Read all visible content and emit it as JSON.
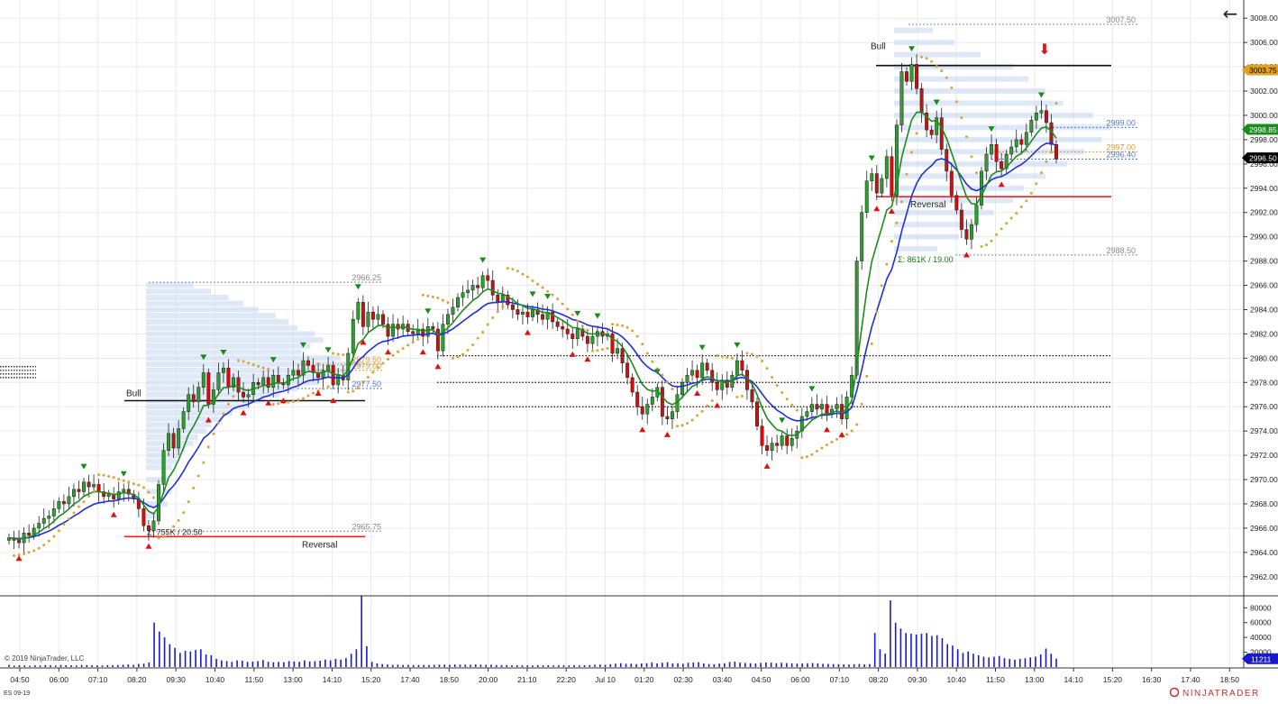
{
  "symbol": "ES 09-19",
  "copyright": "© 2019 NinjaTrader, LLC",
  "brand": "NINJATRADER",
  "icons": {
    "back": "←",
    "down_arrow": "⬇"
  },
  "colors": {
    "bull": "#2e9e2e",
    "bear": "#cc1010",
    "sma_fast": "#1f8a1f",
    "sma_slow": "#1f2fd6",
    "psar": "#d6a43a",
    "volume": "#1a1acc",
    "profile": "#c9d9f2",
    "level_black": "#111111",
    "level_red": "#ee2222",
    "grid": "#eaeaea"
  },
  "chart_data": [
    {
      "type": "candlestick",
      "name": "price",
      "xlabel": "",
      "ylabel": "",
      "ylim": [
        2960.5,
        3009.5
      ],
      "grid": true,
      "x_tick_labels": [
        "04:50",
        "06:00",
        "07:10",
        "08:20",
        "09:30",
        "10:40",
        "11:50",
        "13:00",
        "14:10",
        "15:20",
        "17:40",
        "18:50",
        "20:00",
        "21:10",
        "22:20",
        "Jul 10",
        "01:20",
        "02:30",
        "03:40",
        "04:50",
        "06:00",
        "07:10",
        "08:20",
        "09:30",
        "10:40",
        "11:50",
        "13:00",
        "14:10",
        "15:20",
        "16:30",
        "17:40",
        "18:50"
      ],
      "y_tick_labels": [
        "3008.00",
        "3006.00",
        "3004.00",
        "3002.00",
        "3000.00",
        "2998.00",
        "2996.00",
        "2994.00",
        "2992.00",
        "2990.00",
        "2988.00",
        "2966.00",
        "2984.00",
        "2982.00",
        "2980.00",
        "2978.00",
        "2976.00",
        "2974.00",
        "2972.00",
        "2970.00",
        "2968.00",
        "2966.00",
        "2964.00",
        "2962.00"
      ],
      "y_tick_values": [
        3008,
        3006,
        3004,
        3002,
        3000,
        2998,
        2996,
        2994,
        2992,
        2990,
        2988,
        2986,
        2984,
        2982,
        2980,
        2978,
        2976,
        2974,
        2972,
        2970,
        2968,
        2966,
        2964,
        2962
      ],
      "closes": [
        2965.2,
        2965.0,
        2964.8,
        2965.6,
        2965.4,
        2966.0,
        2966.4,
        2966.8,
        2967.0,
        2967.6,
        2968.2,
        2968.0,
        2968.6,
        2969.2,
        2969.0,
        2969.8,
        2969.4,
        2969.6,
        2969.0,
        2968.6,
        2968.8,
        2968.4,
        2969.0,
        2969.2,
        2968.8,
        2968.4,
        2967.6,
        2966.2,
        2965.8,
        2966.6,
        2969.6,
        2972.4,
        2973.8,
        2972.6,
        2974.2,
        2975.6,
        2977.0,
        2976.4,
        2977.6,
        2978.8,
        2976.2,
        2977.4,
        2978.8,
        2979.2,
        2977.6,
        2978.4,
        2977.2,
        2976.8,
        2977.0,
        2978.0,
        2977.8,
        2978.4,
        2977.6,
        2978.6,
        2978.0,
        2977.8,
        2978.6,
        2979.0,
        2978.6,
        2979.8,
        2979.4,
        2978.8,
        2978.4,
        2979.0,
        2979.4,
        2977.8,
        2978.6,
        2978.2,
        2980.4,
        2983.2,
        2984.6,
        2982.6,
        2983.8,
        2983.2,
        2983.6,
        2982.8,
        2981.8,
        2982.8,
        2982.4,
        2982.8,
        2982.2,
        2982.0,
        2982.4,
        2981.8,
        2982.6,
        2982.4,
        2980.6,
        2982.8,
        2983.6,
        2984.2,
        2985.0,
        2985.4,
        2985.6,
        2986.0,
        2985.8,
        2986.8,
        2986.4,
        2985.2,
        2984.6,
        2985.2,
        2984.4,
        2984.0,
        2983.6,
        2983.8,
        2983.4,
        2984.0,
        2983.6,
        2983.2,
        2983.8,
        2983.0,
        2982.6,
        2982.4,
        2982.0,
        2981.6,
        2982.4,
        2981.8,
        2981.2,
        2981.8,
        2982.2,
        2981.8,
        2982.0,
        2980.4,
        2980.8,
        2979.6,
        2978.4,
        2977.2,
        2976.0,
        2975.4,
        2976.2,
        2976.8,
        2977.6,
        2975.2,
        2975.0,
        2975.6,
        2977.0,
        2978.0,
        2978.6,
        2979.0,
        2978.4,
        2979.6,
        2979.0,
        2978.0,
        2977.4,
        2978.2,
        2977.6,
        2978.6,
        2979.8,
        2979.0,
        2977.4,
        2976.4,
        2974.4,
        2972.8,
        2972.4,
        2973.0,
        2972.8,
        2973.6,
        2972.8,
        2973.4,
        2974.0,
        2975.2,
        2975.6,
        2976.2,
        2975.8,
        2976.2,
        2975.4,
        2975.8,
        2976.2,
        2975.0,
        2976.8,
        2978.6,
        2988.0,
        2992.0,
        2994.6,
        2995.2,
        2993.6,
        2994.8,
        2996.6,
        2993.4,
        2999.2,
        3003.6,
        3002.8,
        3004.2,
        3002.2,
        3000.2,
        2998.8,
        2998.4,
        2999.8,
        2997.2,
        2995.4,
        2993.4,
        2992.2,
        2990.6,
        2989.8,
        2991.0,
        2992.6,
        2995.4,
        2996.8,
        2997.6,
        2996.2,
        2995.6,
        2996.8,
        2997.4,
        2998.0,
        2997.6,
        2998.6,
        2999.6,
        3000.2,
        3000.4,
        2999.4,
        2997.6,
        2996.4
      ],
      "series": [
        {
          "name": "",
          "kind": "line",
          "color_key": "sma_fast"
        },
        {
          "name": "",
          "kind": "line",
          "color_key": "sma_slow"
        },
        {
          "name": "",
          "kind": "dots",
          "color_key": "psar"
        }
      ],
      "profile_bins": [
        {
          "price": 2986.0,
          "width": 0.22
        },
        {
          "price": 2985.5,
          "width": 0.3
        },
        {
          "price": 2985.0,
          "width": 0.38
        },
        {
          "price": 2984.5,
          "width": 0.45
        },
        {
          "price": 2984.0,
          "width": 0.52
        },
        {
          "price": 2983.5,
          "width": 0.6
        },
        {
          "price": 2983.0,
          "width": 0.66
        },
        {
          "price": 2982.5,
          "width": 0.7
        },
        {
          "price": 2982.0,
          "width": 0.78
        },
        {
          "price": 2981.5,
          "width": 0.82
        },
        {
          "price": 2981.0,
          "width": 0.76
        },
        {
          "price": 2980.5,
          "width": 0.72
        },
        {
          "price": 2980.0,
          "width": 0.9
        },
        {
          "price": 2979.5,
          "width": 1.0
        },
        {
          "price": 2979.0,
          "width": 0.94
        },
        {
          "price": 2978.5,
          "width": 0.88
        },
        {
          "price": 2978.0,
          "width": 0.8
        },
        {
          "price": 2977.5,
          "width": 0.7
        },
        {
          "price": 2977.0,
          "width": 0.62
        },
        {
          "price": 2976.5,
          "width": 0.55
        },
        {
          "price": 2976.0,
          "width": 0.48
        },
        {
          "price": 2975.5,
          "width": 0.4
        },
        {
          "price": 2975.0,
          "width": 0.35
        },
        {
          "price": 2974.5,
          "width": 0.3
        },
        {
          "price": 2974.0,
          "width": 0.28
        },
        {
          "price": 2973.5,
          "width": 0.24
        },
        {
          "price": 2973.0,
          "width": 0.22
        },
        {
          "price": 2972.5,
          "width": 0.18
        },
        {
          "price": 2972.0,
          "width": 0.16
        },
        {
          "price": 2971.5,
          "width": 0.14
        },
        {
          "price": 2971.0,
          "width": 0.12
        },
        {
          "price": 2970.0,
          "width": 0.1
        },
        {
          "price": 2969.0,
          "width": 0.12
        },
        {
          "price": 2968.0,
          "width": 0.1
        },
        {
          "price": 2967.0,
          "width": 0.06
        }
      ],
      "profile_bins_2": [
        {
          "price": 3007.0,
          "width": 0.18
        },
        {
          "price": 3006.0,
          "width": 0.28
        },
        {
          "price": 3005.0,
          "width": 0.4
        },
        {
          "price": 3004.0,
          "width": 0.55
        },
        {
          "price": 3003.0,
          "width": 0.62
        },
        {
          "price": 3002.0,
          "width": 0.7
        },
        {
          "price": 3001.0,
          "width": 0.78
        },
        {
          "price": 3000.0,
          "width": 0.92
        },
        {
          "price": 2999.0,
          "width": 1.0
        },
        {
          "price": 2998.0,
          "width": 0.96
        },
        {
          "price": 2997.0,
          "width": 0.88
        },
        {
          "price": 2996.0,
          "width": 0.8
        },
        {
          "price": 2995.0,
          "width": 0.7
        },
        {
          "price": 2994.0,
          "width": 0.6
        },
        {
          "price": 2993.0,
          "width": 0.55
        },
        {
          "price": 2992.0,
          "width": 0.46
        },
        {
          "price": 2991.0,
          "width": 0.38
        },
        {
          "price": 2990.0,
          "width": 0.3
        },
        {
          "price": 2989.0,
          "width": 0.2
        }
      ],
      "levels": [
        {
          "label": "3007.50",
          "price": 3007.5,
          "style": "gray-dotted"
        },
        {
          "label": "2999.00",
          "price": 2999.0,
          "style": "blue-dotted"
        },
        {
          "label": "2997.00",
          "price": 2997.0,
          "style": "orange-dotted"
        },
        {
          "label": "2996.40",
          "price": 2996.4,
          "style": "blue-dotted"
        },
        {
          "label": "2988.50",
          "price": 2988.5,
          "style": "gray-dotted"
        },
        {
          "label": "2966.25",
          "price": 2986.25,
          "style": "gray-dotted"
        },
        {
          "label": "2979.50",
          "price": 2979.5,
          "style": "orange-dotted"
        },
        {
          "label": "2979.00",
          "price": 2979.0,
          "style": "orange-dotted"
        },
        {
          "label": "2977.50",
          "price": 2977.5,
          "style": "blue-dotted"
        },
        {
          "label": "2965.75",
          "price": 2965.75,
          "style": "gray-dotted"
        }
      ],
      "annotations": {
        "bull_label_1": "Bull",
        "bull_label_2": "Bull",
        "reversal_label_1": "Reversal",
        "reversal_label_2": "Reversal",
        "stat_label_1": "Σ: 755K / 20.50",
        "stat_label_2": "Σ: 861K / 19.00"
      },
      "price_badges": [
        {
          "label": "3003.75",
          "price": 3003.75,
          "color": "#e0a020",
          "text_color": "#000000"
        },
        {
          "label": "2998.85",
          "price": 2998.85,
          "color": "#1c8a1c",
          "text_color": "#ffffff"
        },
        {
          "label": "2996.50",
          "price": 2996.5,
          "color": "#000000",
          "text_color": "#ffffff"
        }
      ]
    },
    {
      "type": "bar",
      "name": "volume",
      "ylim": [
        0,
        95000
      ],
      "y_tick_labels": [
        "80000",
        "60000",
        "40000",
        "20000"
      ],
      "y_tick_values": [
        80000,
        60000,
        40000,
        20000
      ],
      "current_value_label": "11211",
      "current_value": 11211,
      "values": [
        3000,
        2000,
        2500,
        2200,
        1800,
        2400,
        2100,
        2600,
        2300,
        2000,
        2800,
        2500,
        2400,
        2200,
        3000,
        2700,
        2500,
        2300,
        2100,
        2600,
        2400,
        2800,
        3100,
        3500,
        3000,
        4200,
        4600,
        6200,
        60000,
        48000,
        40000,
        31000,
        26000,
        19000,
        22000,
        21000,
        23000,
        24000,
        17000,
        16000,
        11000,
        9000,
        8000,
        7000,
        9000,
        8500,
        7000,
        7500,
        8000,
        9500,
        7000,
        6500,
        7000,
        6500,
        8000,
        7500,
        7000,
        9000,
        7500,
        8000,
        8500,
        10000,
        9000,
        11000,
        10000,
        12000,
        18000,
        24000,
        97000,
        28000,
        7000,
        5000,
        4000,
        3500,
        3000,
        3200,
        2800,
        3000,
        2600,
        2800,
        2900,
        2700,
        3000,
        3200,
        3400,
        3000,
        3500,
        3300,
        3200,
        3100,
        3600,
        3300,
        3000,
        3200,
        2800,
        2700,
        2600,
        2400,
        2500,
        2300,
        2400,
        2200,
        2600,
        2300,
        2500,
        2100,
        2400,
        2300,
        2200,
        2600,
        2300,
        2400,
        2800,
        3200,
        3400,
        3000,
        3800,
        4500,
        5200,
        4400,
        4600,
        4000,
        4800,
        5200,
        6200,
        5000,
        5800,
        6600,
        4800,
        5200,
        4400,
        5800,
        6200,
        6600,
        5000,
        4200,
        3800,
        4600,
        5200,
        6800,
        7400,
        6000,
        5600,
        5200,
        4800,
        5600,
        6200,
        6000,
        5200,
        5800,
        5400,
        5000,
        4600,
        4800,
        5200,
        5400,
        5000,
        4400,
        4200,
        4000,
        3800,
        3600,
        3400,
        3800,
        4200,
        3600,
        4000,
        46000,
        24000,
        18000,
        90000,
        60000,
        52000,
        46000,
        45000,
        44000,
        45000,
        46000,
        42000,
        43000,
        39000,
        31000,
        29000,
        24000,
        19000,
        21000,
        18000,
        16000,
        14000,
        13000,
        14000,
        15000,
        12000,
        11000,
        10000,
        11000,
        12000,
        13000,
        14000,
        17000,
        25000,
        18000,
        11211
      ]
    }
  ]
}
